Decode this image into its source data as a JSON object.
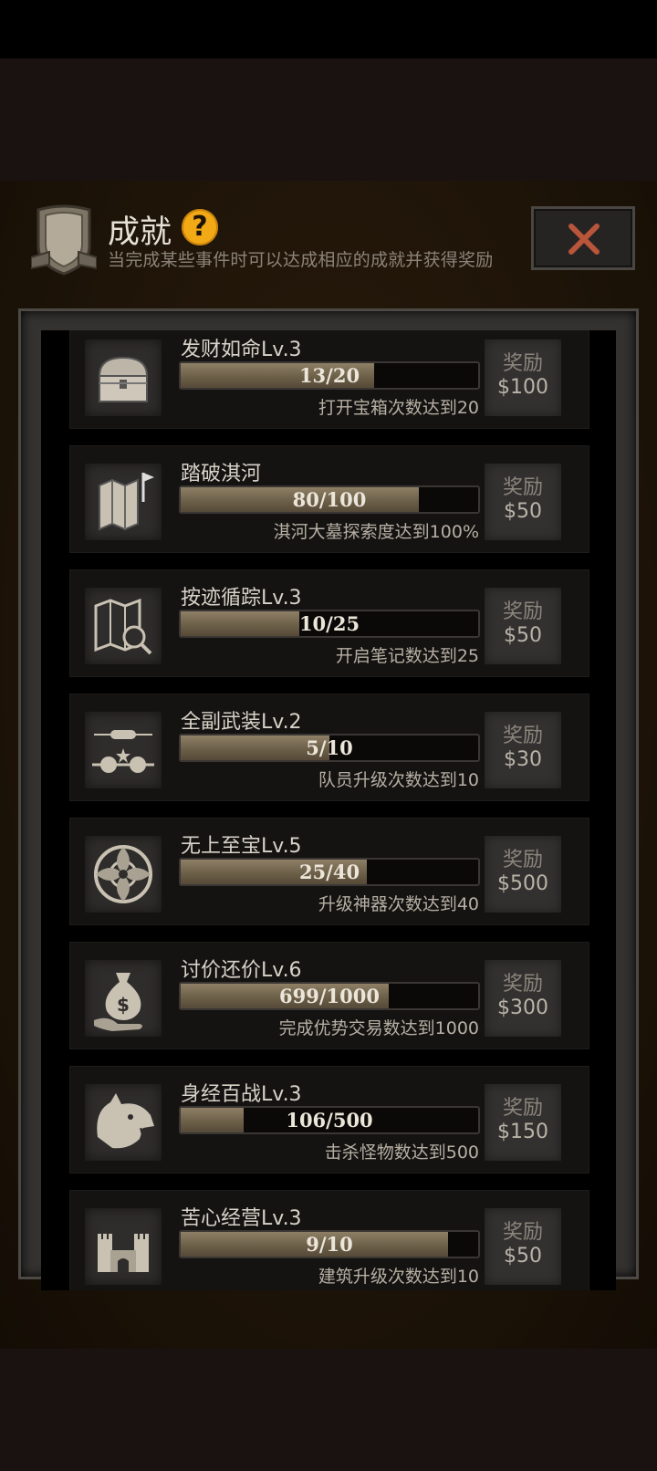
{
  "header": {
    "title": "成就",
    "help": "?",
    "subtitle": "当完成某些事件时可以达成相应的成就并获得奖励"
  },
  "colors": {
    "accent": "#f2a916",
    "close_x": "#b8553a",
    "progress_fill": "#7a6c55"
  },
  "achievements": [
    {
      "icon": "treasure-chest-icon",
      "name": "发财如命Lv.3",
      "progress_text": "13/20",
      "progress": 0.65,
      "desc": "打开宝箱次数达到20",
      "reward_label": "奖励",
      "reward": "$100"
    },
    {
      "icon": "map-flag-icon",
      "name": "踏破淇河",
      "progress_text": "80/100",
      "progress": 0.8,
      "desc": "淇河大墓探索度达到100%",
      "reward_label": "奖励",
      "reward": "$50"
    },
    {
      "icon": "map-search-icon",
      "name": "按迹循踪Lv.3",
      "progress_text": "10/25",
      "progress": 0.4,
      "desc": "开启笔记数达到25",
      "reward_label": "奖励",
      "reward": "$50"
    },
    {
      "icon": "rank-badge-icon",
      "name": "全副武装Lv.2",
      "progress_text": "5/10",
      "progress": 0.5,
      "desc": "队员升级次数达到10",
      "reward_label": "奖励",
      "reward": "$30"
    },
    {
      "icon": "artifact-emblem-icon",
      "name": "无上至宝Lv.5",
      "progress_text": "25/40",
      "progress": 0.625,
      "desc": "升级神器次数达到40",
      "reward_label": "奖励",
      "reward": "$500"
    },
    {
      "icon": "money-bag-icon",
      "name": "讨价还价Lv.6",
      "progress_text": "699/1000",
      "progress": 0.699,
      "desc": "完成优势交易数达到1000",
      "reward_label": "奖励",
      "reward": "$300"
    },
    {
      "icon": "wolf-head-icon",
      "name": "身经百战Lv.3",
      "progress_text": "106/500",
      "progress": 0.212,
      "desc": "击杀怪物数达到500",
      "reward_label": "奖励",
      "reward": "$150"
    },
    {
      "icon": "castle-icon",
      "name": "苦心经营Lv.3",
      "progress_text": "9/10",
      "progress": 0.9,
      "desc": "建筑升级次数达到10",
      "reward_label": "奖励",
      "reward": "$50"
    }
  ]
}
